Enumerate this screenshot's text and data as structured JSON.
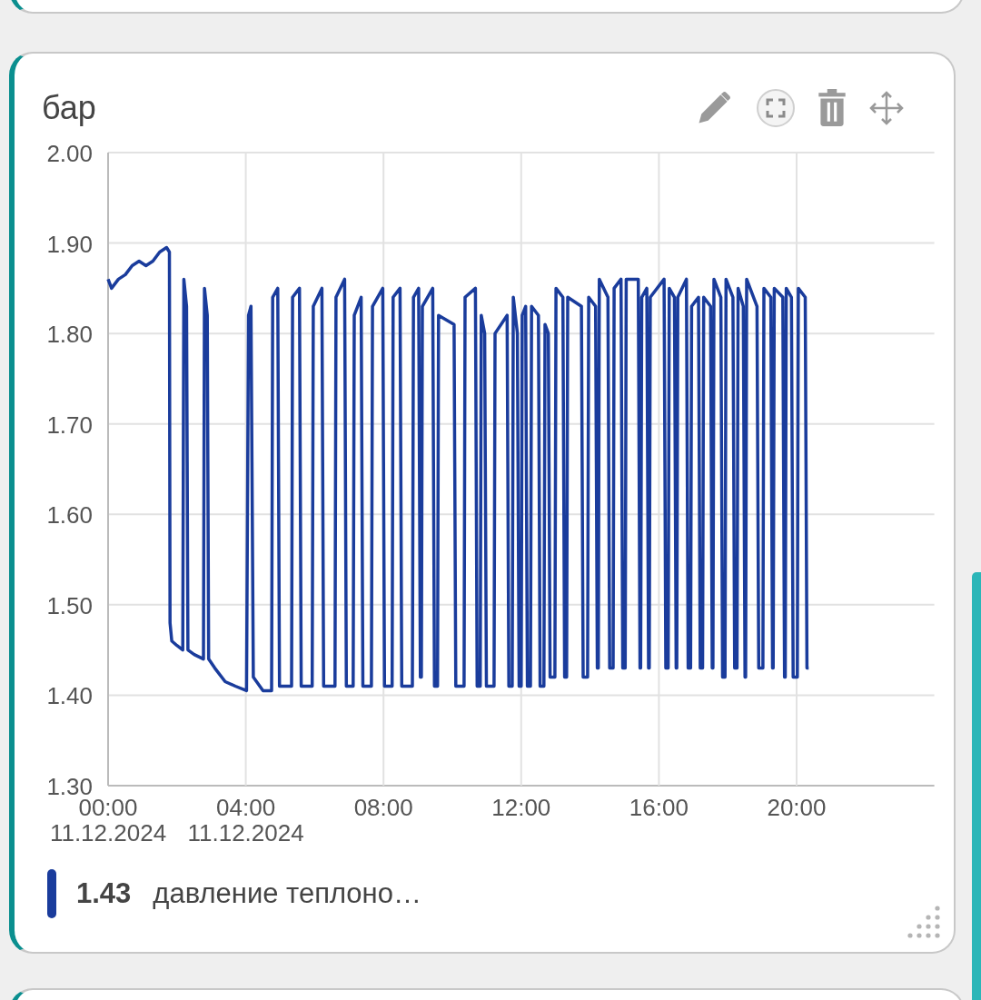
{
  "card": {
    "title": "бар",
    "chart_data": {
      "type": "line",
      "xlim": [
        0,
        24
      ],
      "ylim": [
        1.3,
        2.0
      ],
      "xticks": [
        {
          "value": 0,
          "label": "00:00"
        },
        {
          "value": 4,
          "label": "04:00"
        },
        {
          "value": 8,
          "label": "08:00"
        },
        {
          "value": 12,
          "label": "12:00"
        },
        {
          "value": 16,
          "label": "16:00"
        },
        {
          "value": 20,
          "label": "20:00"
        }
      ],
      "annotations": [
        "11.12.2024",
        "11.12.2024"
      ],
      "grid": true,
      "yticks": [
        {
          "value": 2.0,
          "label": "2.00"
        },
        {
          "value": 1.9,
          "label": "1.90"
        },
        {
          "value": 1.8,
          "label": "1.80"
        },
        {
          "value": 1.7,
          "label": "1.70"
        },
        {
          "value": 1.6,
          "label": "1.60"
        },
        {
          "value": 1.5,
          "label": "1.50"
        },
        {
          "value": 1.4,
          "label": "1.40"
        },
        {
          "value": 1.3,
          "label": "1.30"
        }
      ],
      "x": [
        0,
        0.1,
        0.2,
        0.3,
        0.5,
        0.7,
        0.9,
        1.1,
        1.3,
        1.5,
        1.7,
        1.78,
        1.8,
        1.85,
        2.0,
        2.17,
        2.2,
        2.28,
        2.32,
        2.5,
        2.77,
        2.8,
        2.88,
        2.92,
        3.1,
        3.4,
        3.7,
        4.02,
        4.08,
        4.15,
        4.22,
        4.5,
        4.75,
        4.78,
        4.93,
        4.98,
        5.33,
        5.36,
        5.56,
        5.61,
        5.93,
        5.96,
        6.21,
        6.26,
        6.59,
        6.62,
        6.87,
        6.92,
        7.12,
        7.15,
        7.35,
        7.4,
        7.65,
        7.68,
        7.98,
        8.03,
        8.25,
        8.28,
        8.48,
        8.53,
        8.84,
        8.87,
        9.02,
        9.07,
        9.1,
        9.13,
        9.43,
        9.48,
        9.57,
        9.6,
        10.05,
        10.1,
        10.34,
        10.37,
        10.67,
        10.72,
        10.81,
        10.84,
        10.94,
        10.99,
        11.21,
        11.24,
        11.59,
        11.64,
        11.74,
        11.77,
        11.89,
        11.94,
        12.0,
        12.03,
        12.13,
        12.18,
        12.27,
        12.3,
        12.5,
        12.55,
        12.66,
        12.69,
        12.79,
        12.84,
        12.98,
        13.01,
        13.21,
        13.26,
        13.32,
        13.35,
        13.75,
        13.8,
        13.93,
        13.96,
        14.16,
        14.21,
        14.24,
        14.27,
        14.52,
        14.57,
        14.67,
        14.7,
        14.9,
        14.95,
        15.02,
        15.05,
        15.4,
        15.45,
        15.47,
        15.5,
        15.65,
        15.7,
        15.72,
        15.75,
        16.15,
        16.2,
        16.27,
        16.3,
        16.45,
        16.5,
        16.52,
        16.55,
        16.8,
        16.85,
        16.92,
        16.95,
        17.15,
        17.2,
        17.27,
        17.3,
        17.5,
        17.55,
        17.57,
        17.6,
        17.8,
        17.85,
        17.92,
        17.95,
        18.15,
        18.2,
        18.27,
        18.3,
        18.45,
        18.5,
        18.52,
        18.55,
        18.85,
        18.9,
        19.02,
        19.05,
        19.25,
        19.3,
        19.32,
        19.35,
        19.6,
        19.65,
        19.67,
        19.7,
        19.85,
        19.9,
        20.02,
        20.05,
        20.25,
        20.3,
        20.35
      ],
      "series": [
        {
          "name": "давление теплоно…",
          "color": "#1a3c9c",
          "values": [
            1.86,
            1.85,
            1.855,
            1.86,
            1.865,
            1.875,
            1.88,
            1.875,
            1.88,
            1.89,
            1.895,
            1.89,
            1.48,
            1.46,
            1.455,
            1.45,
            1.86,
            1.83,
            1.45,
            1.445,
            1.44,
            1.85,
            1.82,
            1.44,
            1.43,
            1.415,
            1.41,
            1.405,
            1.82,
            1.83,
            1.42,
            1.405,
            1.405,
            1.84,
            1.85,
            1.41,
            1.41,
            1.84,
            1.85,
            1.41,
            1.41,
            1.83,
            1.85,
            1.41,
            1.41,
            1.84,
            1.86,
            1.41,
            1.41,
            1.82,
            1.84,
            1.41,
            1.41,
            1.83,
            1.85,
            1.41,
            1.41,
            1.84,
            1.85,
            1.41,
            1.41,
            1.84,
            1.85,
            1.42,
            1.42,
            1.83,
            1.85,
            1.41,
            1.41,
            1.82,
            1.81,
            1.41,
            1.41,
            1.84,
            1.85,
            1.41,
            1.41,
            1.82,
            1.8,
            1.41,
            1.41,
            1.8,
            1.82,
            1.41,
            1.41,
            1.84,
            1.8,
            1.41,
            1.41,
            1.82,
            1.83,
            1.41,
            1.41,
            1.83,
            1.82,
            1.41,
            1.41,
            1.81,
            1.8,
            1.42,
            1.42,
            1.85,
            1.84,
            1.42,
            1.42,
            1.84,
            1.83,
            1.42,
            1.42,
            1.84,
            1.83,
            1.43,
            1.43,
            1.86,
            1.84,
            1.43,
            1.43,
            1.85,
            1.86,
            1.43,
            1.43,
            1.86,
            1.86,
            1.43,
            1.43,
            1.84,
            1.85,
            1.43,
            1.43,
            1.84,
            1.86,
            1.43,
            1.43,
            1.85,
            1.84,
            1.43,
            1.43,
            1.84,
            1.86,
            1.43,
            1.43,
            1.83,
            1.84,
            1.43,
            1.43,
            1.84,
            1.83,
            1.43,
            1.43,
            1.86,
            1.84,
            1.42,
            1.42,
            1.86,
            1.84,
            1.43,
            1.43,
            1.85,
            1.83,
            1.42,
            1.42,
            1.86,
            1.83,
            1.43,
            1.43,
            1.85,
            1.84,
            1.43,
            1.43,
            1.85,
            1.84,
            1.42,
            1.42,
            1.85,
            1.84,
            1.42,
            1.42,
            1.85,
            1.84,
            1.43,
            1.43
          ]
        }
      ]
    },
    "legend": [
      {
        "value": "1.43"
      }
    ]
  }
}
